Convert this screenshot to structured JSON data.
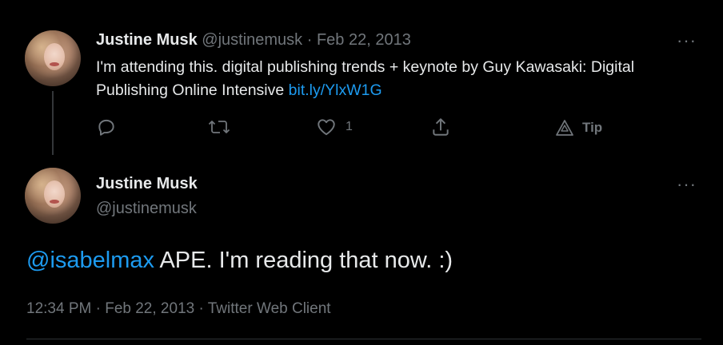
{
  "parent_tweet": {
    "author_name": "Justine Musk",
    "author_handle": "@justinemusk",
    "separator": "·",
    "date": "Feb 22, 2013",
    "text_plain": "I'm attending this. digital publishing trends + keynote by Guy Kawasaki: Digital Publishing Online Intensive ",
    "link_text": "bit.ly/YlxW1G",
    "more_label": "···",
    "actions": {
      "reply_count": "",
      "retweet_count": "",
      "like_count": "1",
      "tip_label": "Tip"
    }
  },
  "main_tweet": {
    "author_name": "Justine Musk",
    "author_handle": "@justinemusk",
    "more_label": "···",
    "mention": "@isabelmax",
    "text": " APE. I'm reading that now. :)",
    "time": "12:34 PM",
    "separator1": "·",
    "date": "Feb 22, 2013",
    "separator2": "·",
    "source": "Twitter Web Client"
  },
  "colors": {
    "background": "#000000",
    "text": "#e7e9ea",
    "muted": "#71767b",
    "link": "#1d9bf0"
  }
}
